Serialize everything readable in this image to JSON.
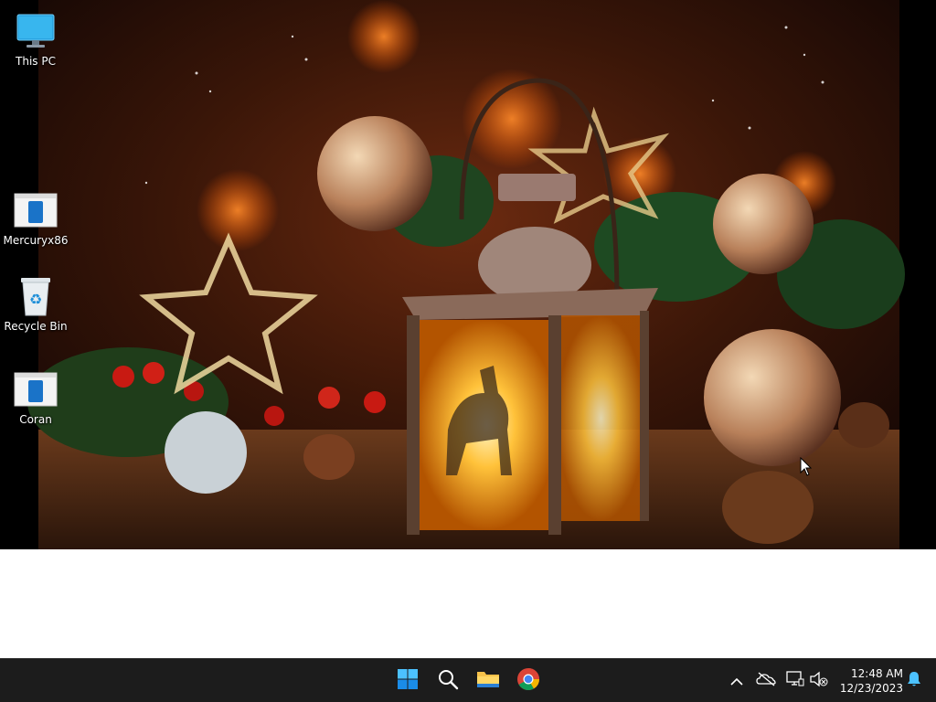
{
  "desktop": {
    "icons": [
      {
        "label": "This PC",
        "icon": "computer-icon"
      },
      {
        "label": "Mercuryx86",
        "icon": "app-icon"
      },
      {
        "label": "Recycle Bin",
        "icon": "recycle-bin-icon"
      },
      {
        "label": "Coran",
        "icon": "app-icon"
      }
    ]
  },
  "taskbar": {
    "pinned": [
      {
        "name": "Start",
        "icon": "windows-start-icon"
      },
      {
        "name": "Search",
        "icon": "search-icon"
      },
      {
        "name": "File Explorer",
        "icon": "folder-icon"
      },
      {
        "name": "Google Chrome",
        "icon": "chrome-icon"
      }
    ],
    "tray": {
      "icons": [
        "chevron-up-icon",
        "onedrive-offline-icon",
        "network-icon",
        "volume-muted-icon"
      ],
      "time": "12:48 AM",
      "date": "12/23/2023",
      "notification_icon": "bell-icon"
    }
  },
  "colors": {
    "taskbar_bg": "#1c1c1c",
    "accent": "#0078d4"
  }
}
